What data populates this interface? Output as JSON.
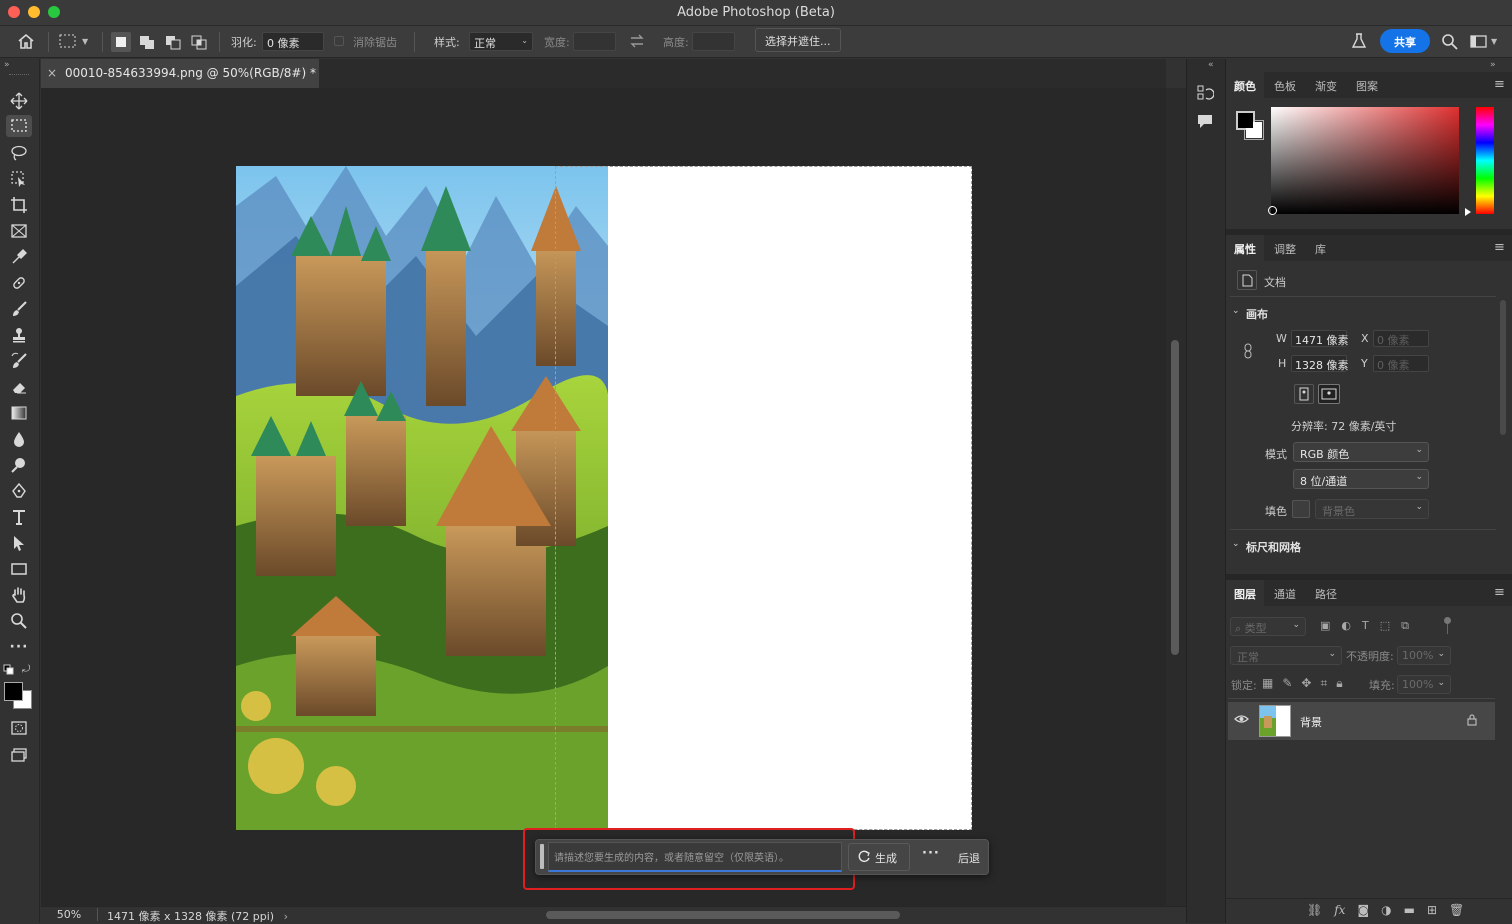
{
  "window": {
    "title": "Adobe Photoshop (Beta)"
  },
  "options_bar": {
    "feather_label": "羽化:",
    "feather_value": "0 像素",
    "antialias_label": "消除锯齿",
    "style_label": "样式:",
    "style_value": "正常",
    "width_label": "宽度:",
    "height_label": "高度:",
    "select_mask_button": "选择并遮住...",
    "share_button": "共享"
  },
  "document": {
    "tab_title": "00010-854633994.png @ 50%(RGB/8#) *",
    "zoom": "50%",
    "status_info": "1471 像素 x 1328 像素 (72 ppi)"
  },
  "context_bar": {
    "prompt_placeholder": "请描述您要生成的内容，或者随意留空（仅限英语）。",
    "generate_label": "生成",
    "more_label": "···",
    "back_label": "后退"
  },
  "color_panel": {
    "tabs": [
      "颜色",
      "色板",
      "渐变",
      "图案"
    ],
    "foreground": "#000000",
    "background": "#ffffff",
    "hue_color": "#e03030"
  },
  "properties_panel": {
    "tabs": [
      "属性",
      "调整",
      "库"
    ],
    "doc_label": "文档",
    "canvas_section": "画布",
    "w_label": "W",
    "w_value": "1471 像素",
    "h_label": "H",
    "h_value": "1328 像素",
    "x_label": "X",
    "x_placeholder": "0 像素",
    "y_label": "Y",
    "y_placeholder": "0 像素",
    "resolution": "分辨率: 72 像素/英寸",
    "mode_label": "模式",
    "mode_value": "RGB 颜色",
    "depth_value": "8 位/通道",
    "fill_label": "填色",
    "fill_value": "背景色",
    "rulers_section": "标尺和网格"
  },
  "layers_panel": {
    "tabs": [
      "图层",
      "通道",
      "路径"
    ],
    "filter_placeholder": "类型",
    "blend_mode": "正常",
    "opacity_label": "不透明度:",
    "opacity_value": "100%",
    "lock_label": "锁定:",
    "fill_label": "填充:",
    "fill_value": "100%",
    "layers": [
      {
        "name": "背景",
        "visible": true,
        "locked": true
      }
    ]
  }
}
